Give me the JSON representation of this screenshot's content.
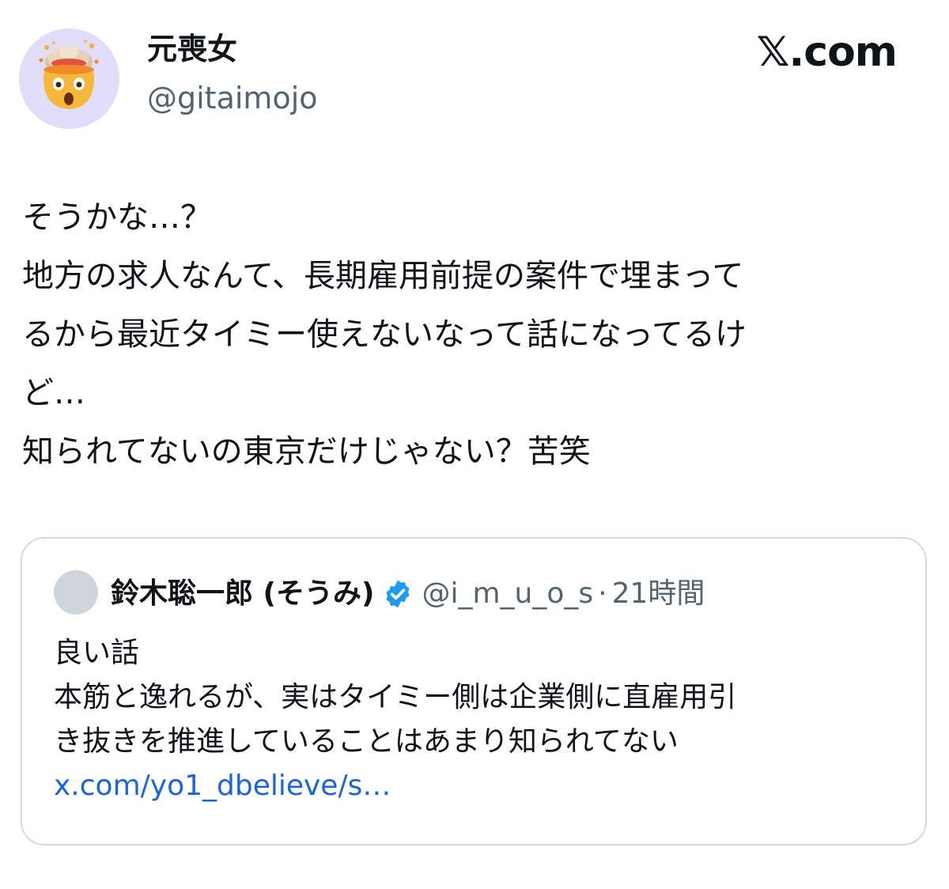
{
  "author": {
    "display_name": "元喪女",
    "handle": "@gitaimojo",
    "avatar_icon": "exploding-head-emoji-icon",
    "avatar_bg": "#e1dcf7"
  },
  "brand": {
    "label": "𝕏.com"
  },
  "tweet": {
    "lines": [
      "そうかな…？",
      "地方の求人なんて、長期雇用前提の案件で埋まって",
      "るから最近タイミー使えないなって話になってるけ",
      "ど…",
      "知られてないの東京だけじゃない？苦笑"
    ]
  },
  "quote": {
    "display_name": "鈴木聡一郎 (そうみ)",
    "verified_icon": "verified-badge-icon",
    "handle": "@i_m_u_o_s",
    "separator": "·",
    "time": "21時間",
    "lines": [
      "良い話",
      "本筋と逸れるが、実はタイミー側は企業側に直雇用引",
      "き抜きを推進していることはあまり知られてない"
    ],
    "link": "x.com/yo1_dbelieve/s…"
  },
  "colors": {
    "text": "#0f1419",
    "secondary_text": "#536471",
    "link": "#1d64d4",
    "verified": "#1d9bf0",
    "border": "#d6dbdf"
  }
}
